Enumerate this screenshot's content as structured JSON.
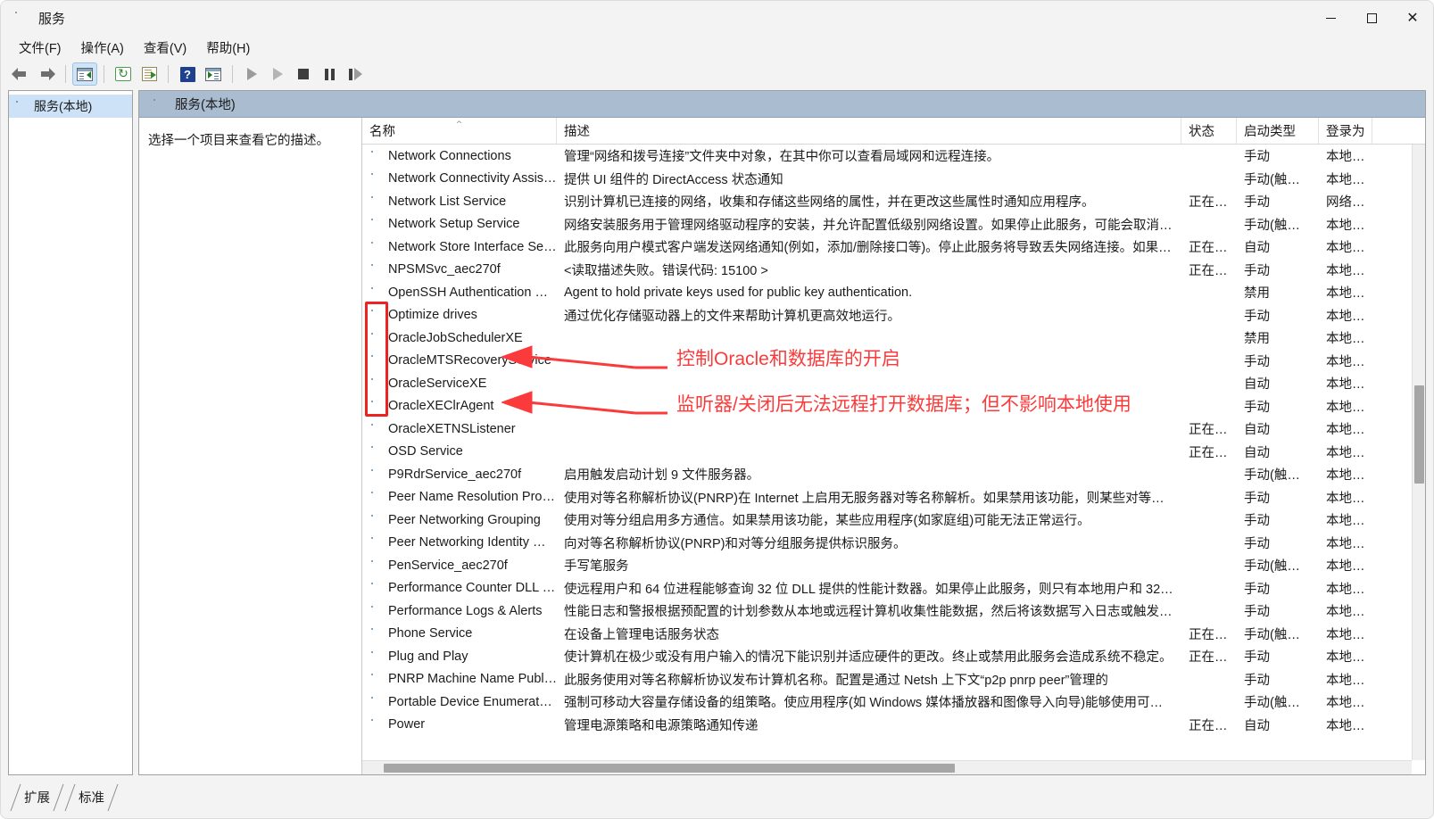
{
  "window": {
    "title": "服务",
    "icon": "services-gear-icon",
    "controls": {
      "minimize": "最小化",
      "maximize": "最大化",
      "close": "关闭"
    }
  },
  "menubar": [
    {
      "label": "文件(F)",
      "name": "menu-file"
    },
    {
      "label": "操作(A)",
      "name": "menu-action"
    },
    {
      "label": "查看(V)",
      "name": "menu-view"
    },
    {
      "label": "帮助(H)",
      "name": "menu-help"
    }
  ],
  "toolbar": [
    {
      "name": "back-button",
      "icon": "arrow-left-icon"
    },
    {
      "name": "forward-button",
      "icon": "arrow-right-icon"
    },
    {
      "name": "show-hide-console-tree-button",
      "icon": "console-tree-icon",
      "active": true
    },
    {
      "name": "refresh-button",
      "icon": "refresh-icon"
    },
    {
      "name": "export-list-button",
      "icon": "export-list-icon"
    },
    {
      "name": "help-button",
      "icon": "help-icon"
    },
    {
      "name": "properties-button",
      "icon": "properties-window-icon"
    },
    {
      "name": "start-service-button",
      "icon": "play-icon"
    },
    {
      "name": "resume-service-button",
      "icon": "play-outline-icon"
    },
    {
      "name": "stop-service-button",
      "icon": "stop-icon"
    },
    {
      "name": "pause-service-button",
      "icon": "pause-icon"
    },
    {
      "name": "restart-service-button",
      "icon": "restart-icon"
    }
  ],
  "tree": {
    "items": [
      {
        "label": "服务(本地)",
        "icon": "services-gear-icon",
        "selected": true
      }
    ]
  },
  "pane": {
    "header_title": "服务(本地)",
    "header_icon": "services-gear-icon",
    "description_placeholder": "选择一个项目来查看它的描述。"
  },
  "table": {
    "columns": [
      {
        "key": "name",
        "label": "名称",
        "sorted": "asc"
      },
      {
        "key": "description",
        "label": "描述"
      },
      {
        "key": "status",
        "label": "状态"
      },
      {
        "key": "startup",
        "label": "启动类型"
      },
      {
        "key": "logon",
        "label": "登录为"
      }
    ],
    "rows": [
      {
        "name": "Network Connections",
        "description": "管理“网络和拨号连接”文件夹中对象，在其中你可以查看局域网和远程连接。",
        "status": "",
        "startup": "手动",
        "logon": "本地系…"
      },
      {
        "name": "Network Connectivity Assis…",
        "description": "提供 UI 组件的 DirectAccess 状态通知",
        "status": "",
        "startup": "手动(触发…",
        "logon": "本地系…"
      },
      {
        "name": "Network List Service",
        "description": "识别计算机已连接的网络，收集和存储这些网络的属性，并在更改这些属性时通知应用程序。",
        "status": "正在…",
        "startup": "手动",
        "logon": "网络服…"
      },
      {
        "name": "Network Setup Service",
        "description": "网络安装服务用于管理网络驱动程序的安装，并允许配置低级别网络设置。如果停止此服务，可能会取消…",
        "status": "",
        "startup": "手动(触发…",
        "logon": "本地系…"
      },
      {
        "name": "Network Store Interface Se…",
        "description": "此服务向用户模式客户端发送网络通知(例如，添加/删除接口等)。停止此服务将导致丢失网络连接。如果…",
        "status": "正在…",
        "startup": "自动",
        "logon": "本地服…"
      },
      {
        "name": "NPSMSvc_aec270f",
        "description": "<读取描述失败。错误代码: 15100 >",
        "status": "正在…",
        "startup": "手动",
        "logon": "本地系…"
      },
      {
        "name": "OpenSSH Authentication …",
        "description": "Agent to hold private keys used for public key authentication.",
        "status": "",
        "startup": "禁用",
        "logon": "本地系…"
      },
      {
        "name": "Optimize drives",
        "description": "通过优化存储驱动器上的文件来帮助计算机更高效地运行。",
        "status": "",
        "startup": "手动",
        "logon": "本地系…"
      },
      {
        "name": "OracleJobSchedulerXE",
        "description": "",
        "status": "",
        "startup": "禁用",
        "logon": "本地系…",
        "highlighted": true
      },
      {
        "name": "OracleMTSRecoveryService",
        "description": "",
        "status": "",
        "startup": "手动",
        "logon": "本地系…",
        "highlighted": true
      },
      {
        "name": "OracleServiceXE",
        "description": "",
        "status": "",
        "startup": "自动",
        "logon": "本地系…",
        "highlighted": true
      },
      {
        "name": "OracleXEClrAgent",
        "description": "",
        "status": "",
        "startup": "手动",
        "logon": "本地系…",
        "highlighted": true
      },
      {
        "name": "OracleXETNSListener",
        "description": "",
        "status": "正在…",
        "startup": "自动",
        "logon": "本地系…",
        "highlighted": true
      },
      {
        "name": "OSD Service",
        "description": "",
        "status": "正在…",
        "startup": "自动",
        "logon": "本地系…"
      },
      {
        "name": "P9RdrService_aec270f",
        "description": "启用触发启动计划 9 文件服务器。",
        "status": "",
        "startup": "手动(触发…",
        "logon": "本地系…"
      },
      {
        "name": "Peer Name Resolution Pro…",
        "description": "使用对等名称解析协议(PNRP)在 Internet 上启用无服务器对等名称解析。如果禁用该功能，则某些对等应…",
        "status": "",
        "startup": "手动",
        "logon": "本地服…"
      },
      {
        "name": "Peer Networking Grouping",
        "description": "使用对等分组启用多方通信。如果禁用该功能，某些应用程序(如家庭组)可能无法正常运行。",
        "status": "",
        "startup": "手动",
        "logon": "本地服…"
      },
      {
        "name": "Peer Networking Identity …",
        "description": "向对等名称解析协议(PNRP)和对等分组服务提供标识服务。",
        "status": "",
        "startup": "手动",
        "logon": "本地服…"
      },
      {
        "name": "PenService_aec270f",
        "description": "手写笔服务",
        "status": "",
        "startup": "手动(触发…",
        "logon": "本地系…"
      },
      {
        "name": "Performance Counter DLL …",
        "description": "使远程用户和 64 位进程能够查询 32 位 DLL 提供的性能计数器。如果停止此服务，则只有本地用户和 32 …",
        "status": "",
        "startup": "手动",
        "logon": "本地服…"
      },
      {
        "name": "Performance Logs & Alerts",
        "description": "性能日志和警报根据预配置的计划参数从本地或远程计算机收集性能数据，然后将该数据写入日志或触发…",
        "status": "",
        "startup": "手动",
        "logon": "本地服…"
      },
      {
        "name": "Phone Service",
        "description": "在设备上管理电话服务状态",
        "status": "正在…",
        "startup": "手动(触发…",
        "logon": "本地服…"
      },
      {
        "name": "Plug and Play",
        "description": "使计算机在极少或没有用户输入的情况下能识别并适应硬件的更改。终止或禁用此服务会造成系统不稳定。",
        "status": "正在…",
        "startup": "手动",
        "logon": "本地系…"
      },
      {
        "name": "PNRP Machine Name Publ…",
        "description": "此服务使用对等名称解析协议发布计算机名称。配置是通过 Netsh 上下文“p2p pnrp peer”管理的",
        "status": "",
        "startup": "手动",
        "logon": "本地服…"
      },
      {
        "name": "Portable Device Enumerat…",
        "description": "强制可移动大容量存储设备的组策略。使应用程序(如 Windows 媒体播放器和图像导入向导)能够使用可移…",
        "status": "",
        "startup": "手动(触发…",
        "logon": "本地系…"
      },
      {
        "name": "Power",
        "description": "管理电源策略和电源策略通知传递",
        "status": "正在…",
        "startup": "自动",
        "logon": "本地系…"
      }
    ]
  },
  "annotations": [
    {
      "name": "annotation-oracle-service",
      "text": "控制Oracle和数据库的开启",
      "color": "#fb3b3b"
    },
    {
      "name": "annotation-oracle-listener",
      "text": "监听器/关闭后无法远程打开数据库；但不影响本地使用",
      "color": "#fb3b3b"
    }
  ],
  "bottom_tabs": [
    {
      "label": "扩展",
      "name": "tab-extended",
      "selected": false
    },
    {
      "label": "标准",
      "name": "tab-standard",
      "selected": true
    }
  ],
  "colors": {
    "annotation_red": "#fb3b3b",
    "highlight_box_red": "#ee2222",
    "pane_header_bg": "#a9bcd0",
    "tree_selected_bg": "#cde2f7",
    "window_bg": "#f3f3f3"
  }
}
